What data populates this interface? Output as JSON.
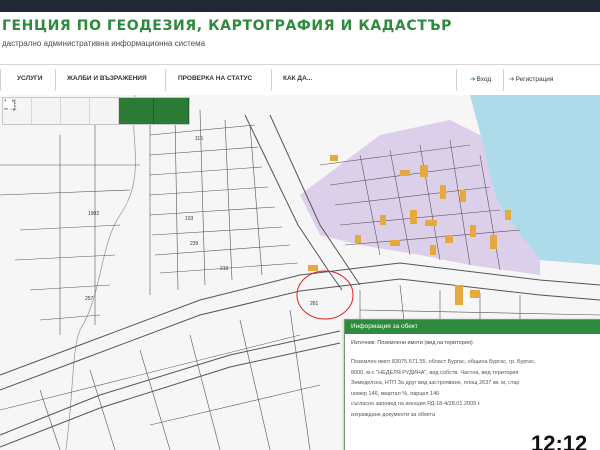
{
  "header": {
    "title": "ГЕНЦИЯ ПО ГЕОДЕЗИЯ, КАРТОГРАФИЯ И КАДАСТЪР",
    "subtitle": "дастрално административна информационна система",
    "title_color": "#2e8a3c"
  },
  "nav": {
    "items": [
      "УСЛУГИ",
      "ЖАЛБИ И ВЪЗРАЖЕНИЯ",
      "ПРОВЕРКА НА СТАТУС",
      "КАК ДА..."
    ],
    "login": "Вход",
    "register": "Регистрация"
  },
  "toolbar": {
    "icons": [
      "select-icon",
      "pencil-icon",
      "measure-icon",
      "upload-icon",
      "location-pin-icon",
      "print-icon"
    ],
    "accent_color": "#2b7a35"
  },
  "map": {
    "parcel_numbers": [
      "1902",
      "257",
      "219",
      "239",
      "261",
      "103",
      "115"
    ],
    "zone_color": "#d9cde8",
    "building_color": "#e4a640",
    "sea_color": "#a9d8ea"
  },
  "popup": {
    "title": "Информация за обект",
    "subtitle": "Източник: Поземлени имоти (вид на територия)",
    "lines": [
      "Поземлен имот 83075.571.55, област Бургас, община Бургас, гр. Бургас,",
      "8000, м-с \"НЕДЕЛЯ РУДИНА\", вид собств. Частна, вид територия",
      "Земеделска, НТП За друг вид застрояване, площ 2637 кв. м, стар",
      "номер 146, квартал %, парцел 146",
      "съгласно заповед на агенция РД-18-4/28.01.2009 г.",
      "изграждане документи за обекта"
    ]
  },
  "clock": "12:12"
}
